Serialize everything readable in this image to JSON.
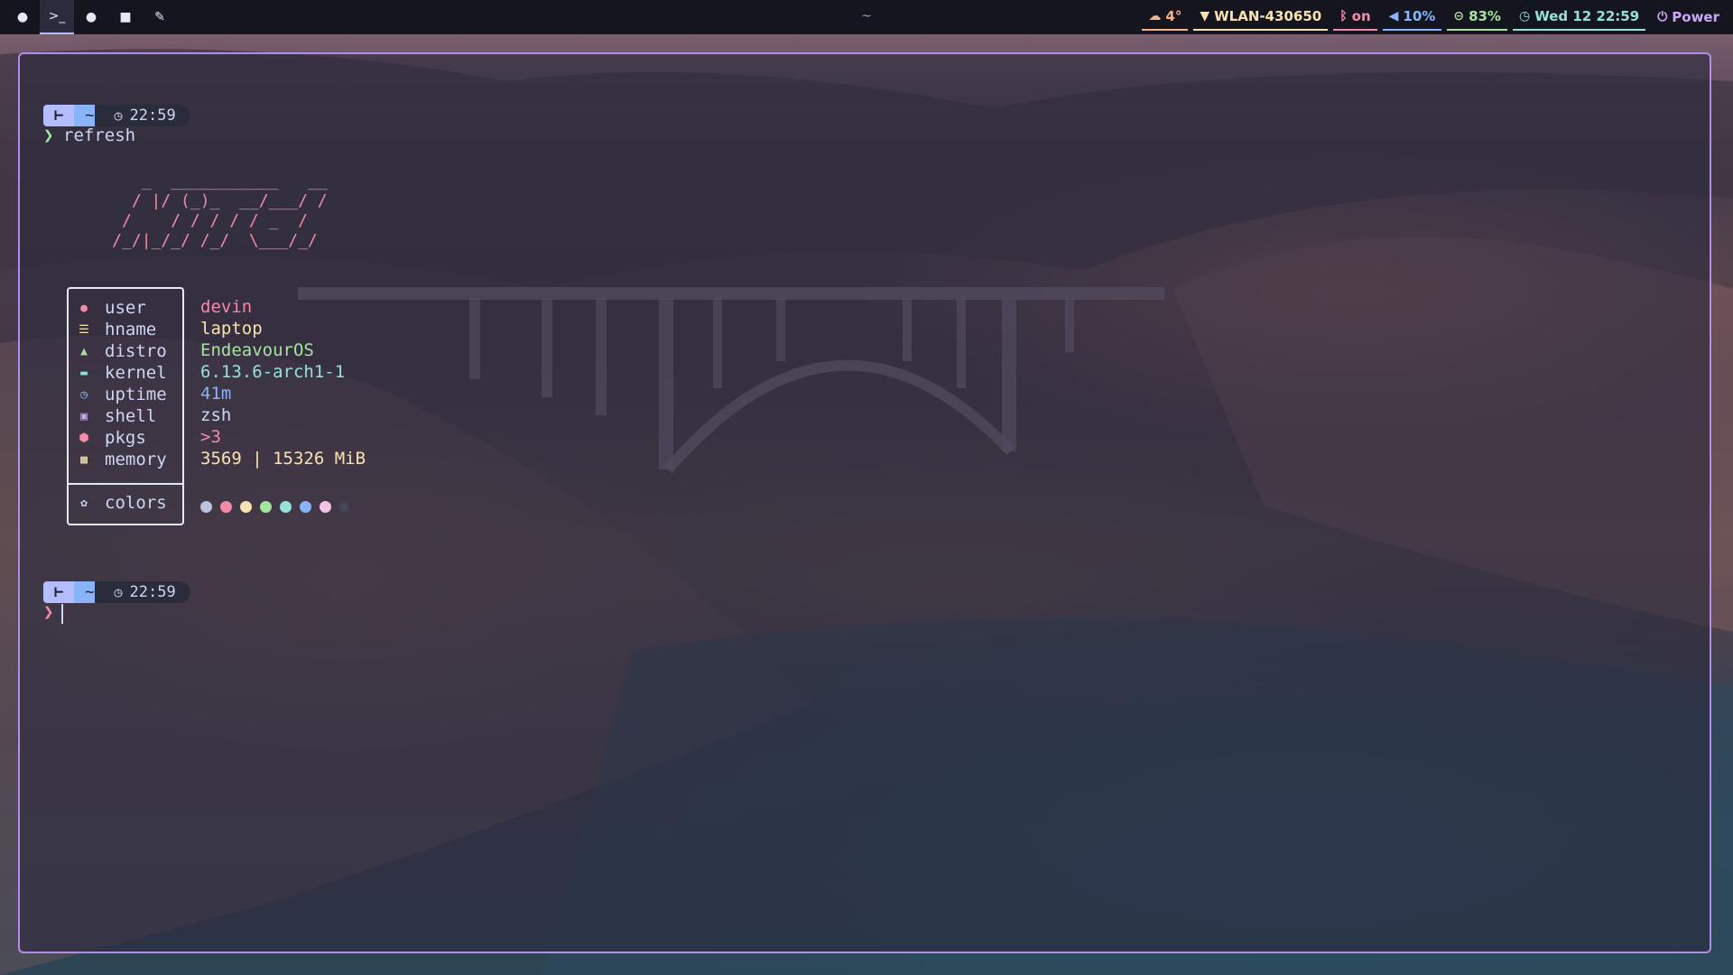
{
  "topbar": {
    "workspaces": [
      {
        "icon": "arch-logo-icon",
        "glyph": "●",
        "active": false
      },
      {
        "icon": "terminal-icon",
        "glyph": ">_",
        "active": true
      },
      {
        "icon": "chat-icon",
        "glyph": "●",
        "active": false
      },
      {
        "icon": "mail-icon",
        "glyph": "■",
        "active": false
      },
      {
        "icon": "brush-icon",
        "glyph": "✎",
        "active": false
      }
    ],
    "window_title": "~",
    "weather": {
      "icon": "cloud-icon",
      "text": "4°",
      "color": "#fab387"
    },
    "wifi": {
      "icon": "wifi-icon",
      "text": "WLAN-430650",
      "color": "#f9e2af"
    },
    "bluetooth": {
      "icon": "bluetooth-icon",
      "text": "on",
      "color": "#f38ba8"
    },
    "volume": {
      "icon": "volume-icon",
      "text": "10%",
      "color": "#89b4fa"
    },
    "battery": {
      "icon": "battery-icon",
      "text": "83%",
      "color": "#a6e3a1"
    },
    "clock": {
      "icon": "clock-icon",
      "text": "Wed 12 22:59",
      "color": "#94e2d5"
    },
    "power": {
      "icon": "power-icon",
      "text": "Power",
      "color": "#cba6f7"
    }
  },
  "terminal": {
    "prompt1": {
      "dir": "~",
      "time": "22:59",
      "command": "refresh"
    },
    "ascii_art": "        _  ___________   __\n       / |/ (_)_  __/___/ /\n      /    / / / / / _  /\n     /_/|_/_/ /_/  \\___/_/",
    "info": [
      {
        "icon": "user-icon",
        "label": "user",
        "value": "devin",
        "color": "#f38ba8"
      },
      {
        "icon": "hostname-icon",
        "label": "hname",
        "value": "laptop",
        "color": "#f9e2af"
      },
      {
        "icon": "distro-icon",
        "label": "distro",
        "value": "EndeavourOS",
        "color": "#a6e3a1"
      },
      {
        "icon": "kernel-icon",
        "label": "kernel",
        "value": "6.13.6-arch1-1",
        "color": "#94e2d5"
      },
      {
        "icon": "uptime-icon",
        "label": "uptime",
        "value": "41m",
        "color": "#89b4fa"
      },
      {
        "icon": "shell-icon",
        "label": "shell",
        "value": "zsh",
        "color": "#cdd6f4"
      },
      {
        "icon": "package-icon",
        "label": "pkgs",
        "value": ">3",
        "color": "#f38ba8"
      },
      {
        "icon": "memory-icon",
        "label": "memory",
        "value": "3569 | 15326 MiB",
        "color": "#f9e2af"
      }
    ],
    "colors_label": "colors",
    "palette": [
      "#bac2de",
      "#f38ba8",
      "#f9e2af",
      "#a6e3a1",
      "#94e2d5",
      "#89b4fa",
      "#f5c2e7",
      "#45475a"
    ],
    "prompt2": {
      "dir": "~",
      "time": "22:59",
      "command": ""
    }
  }
}
